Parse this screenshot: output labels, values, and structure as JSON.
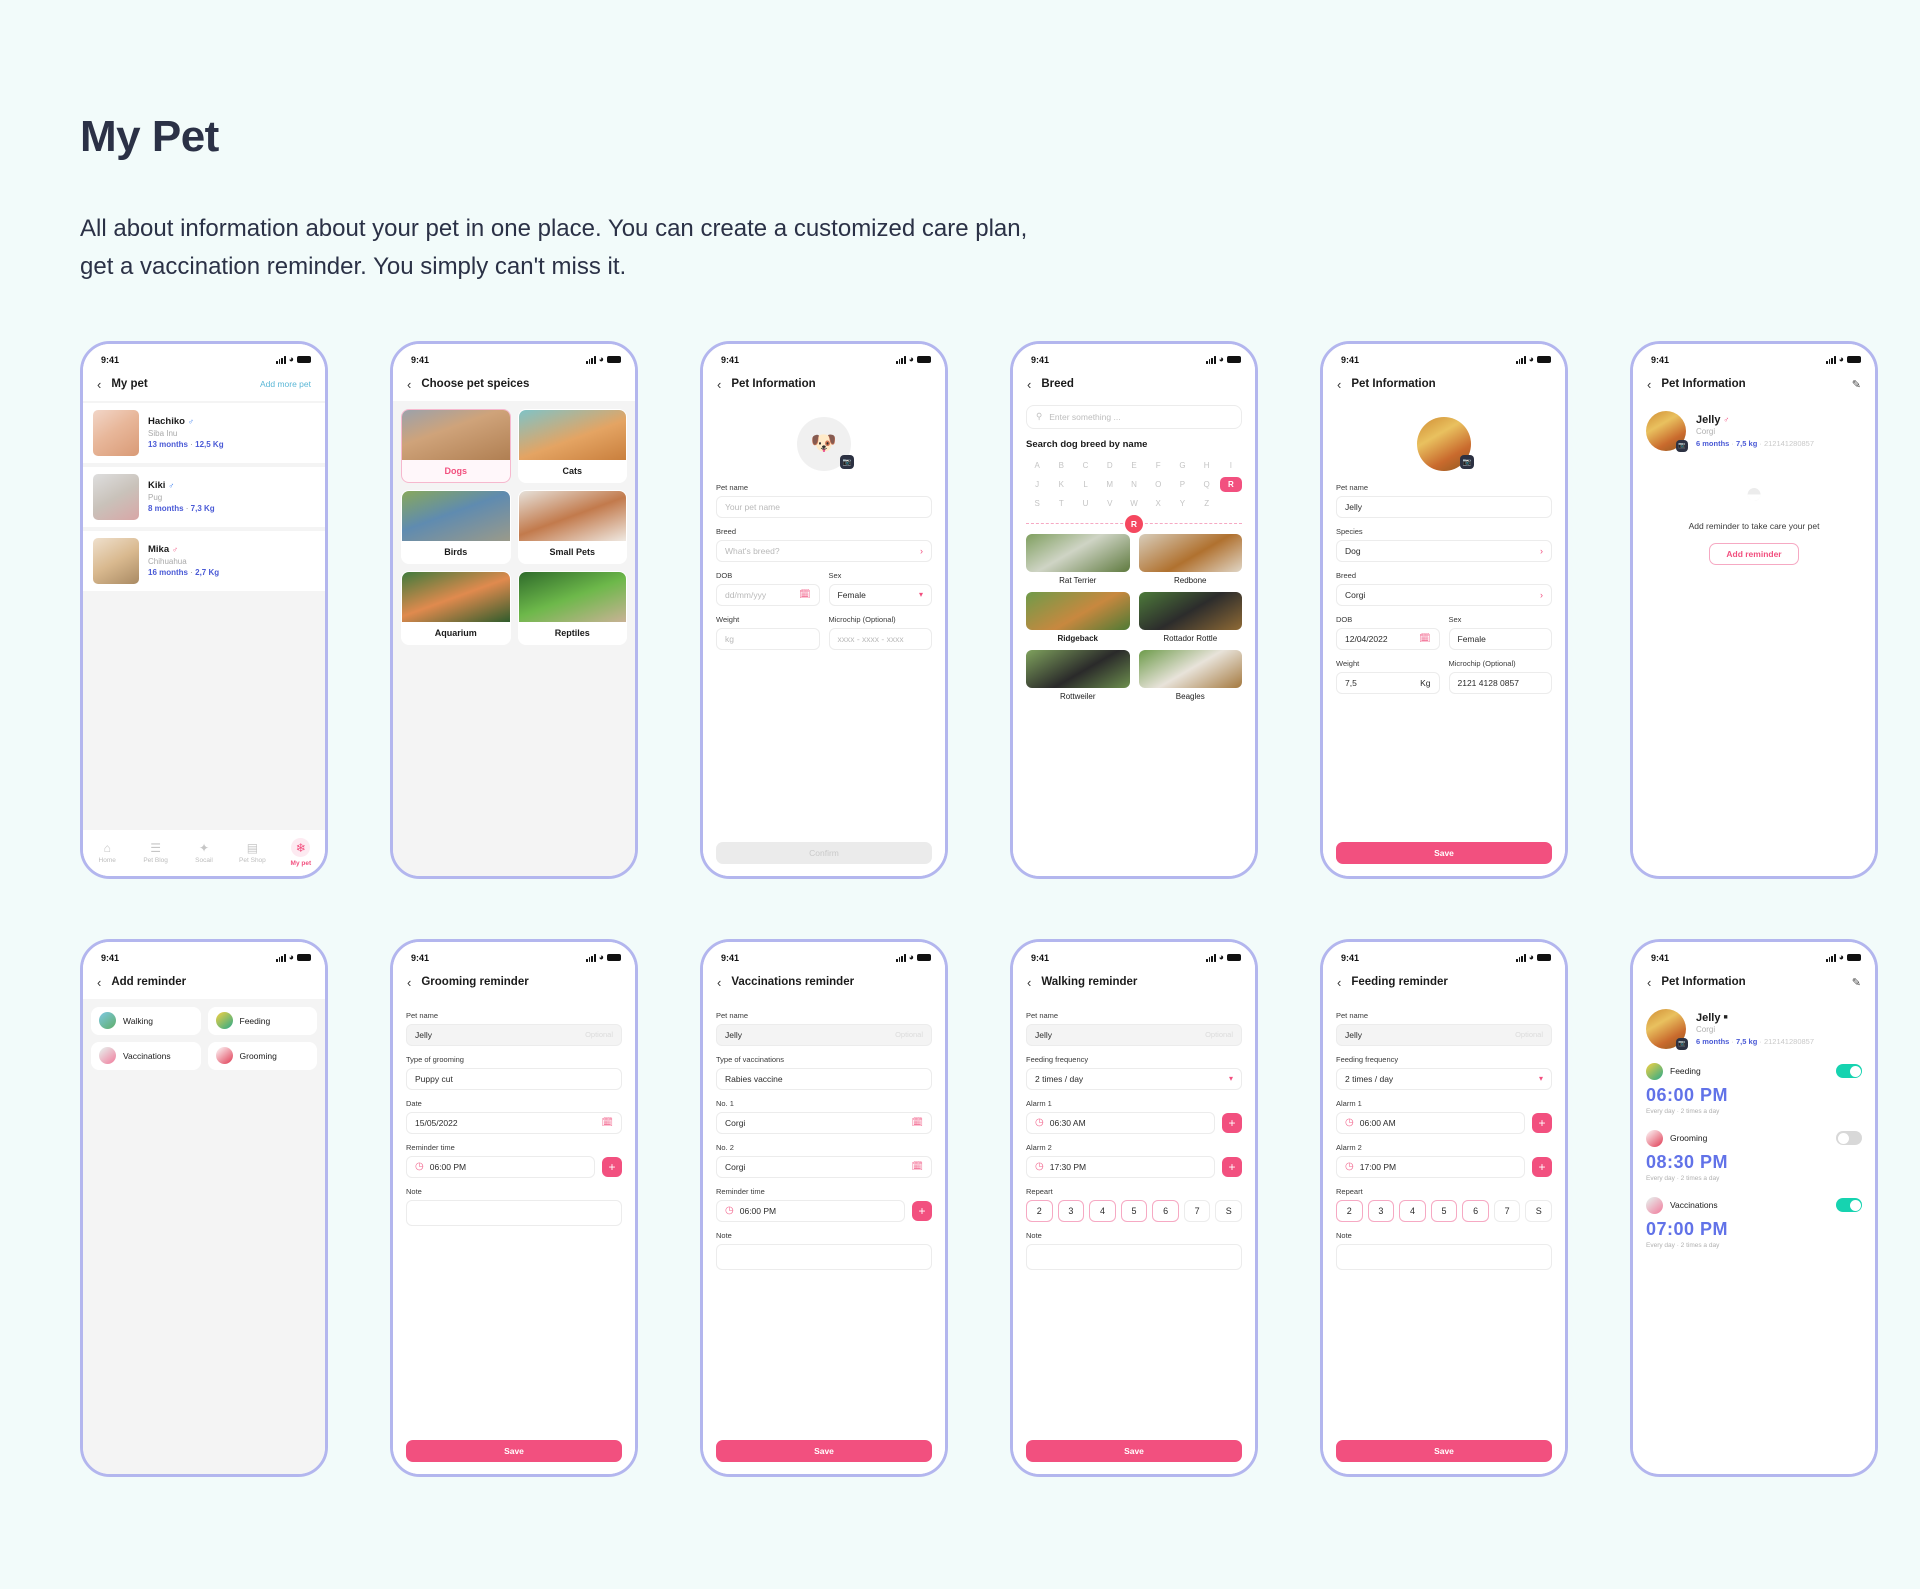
{
  "page": {
    "title": "My Pet",
    "subtitle": "All about information about your pet in one place. You can create a customized care plan, get a vaccination reminder. You simply can't miss it."
  },
  "status_bar": {
    "time": "9:41"
  },
  "colors": {
    "accent_pink": "#f2507f",
    "link_blue": "#4a5ad6",
    "toggle_green": "#16d3b0",
    "frame_purple": "#b3b6ee",
    "page_bg": "#f2fbfa"
  },
  "screens": {
    "my_pet": {
      "title": "My pet",
      "action": "Add more pet",
      "pets": [
        {
          "name": "Hachiko",
          "sex": "male",
          "breed": "Siba Inu",
          "age": "13 months",
          "weight": "12,5 Kg"
        },
        {
          "name": "Kiki",
          "sex": "male",
          "breed": "Pug",
          "age": "8 months",
          "weight": "7,3 Kg"
        },
        {
          "name": "Mika",
          "sex": "male",
          "breed": "Chihuahua",
          "age": "16 months",
          "weight": "2,7 Kg"
        }
      ],
      "tabs": [
        {
          "label": "Home",
          "icon": "home-icon",
          "active": false
        },
        {
          "label": "Pet Blog",
          "icon": "blog-icon",
          "active": false
        },
        {
          "label": "Socail",
          "icon": "social-icon",
          "active": false
        },
        {
          "label": "Pet Shop",
          "icon": "shop-icon",
          "active": false
        },
        {
          "label": "My pet",
          "icon": "paw-icon",
          "active": true
        }
      ]
    },
    "choose_species": {
      "title": "Choose pet speices",
      "items": [
        {
          "label": "Dogs",
          "selected": true
        },
        {
          "label": "Cats",
          "selected": false
        },
        {
          "label": "Birds",
          "selected": false
        },
        {
          "label": "Small Pets",
          "selected": false
        },
        {
          "label": "Aquarium",
          "selected": false
        },
        {
          "label": "Reptiles",
          "selected": false
        }
      ]
    },
    "pet_info_empty": {
      "title": "Pet Information",
      "fields": {
        "pet_name_label": "Pet name",
        "pet_name_placeholder": "Your pet name",
        "breed_label": "Breed",
        "breed_placeholder": "What's breed?",
        "dob_label": "DOB",
        "dob_placeholder": "dd/mm/yyy",
        "sex_label": "Sex",
        "sex_value": "Female",
        "weight_label": "Weight",
        "weight_placeholder": "kg",
        "microchip_label": "Microchip (Optional)",
        "microchip_placeholder": "xxxx - xxxx - xxxx"
      },
      "confirm_label": "Confirm"
    },
    "breed": {
      "title": "Breed",
      "search_placeholder": "Enter something ...",
      "section_title": "Search dog breed by name",
      "letters": [
        "A",
        "B",
        "C",
        "D",
        "E",
        "F",
        "G",
        "H",
        "I",
        "J",
        "K",
        "L",
        "M",
        "N",
        "O",
        "P",
        "Q",
        "R",
        "S",
        "T",
        "U",
        "V",
        "W",
        "X",
        "Y",
        "Z"
      ],
      "active_letter": "R",
      "results": [
        {
          "name": "Rat Terrier",
          "bold": false
        },
        {
          "name": "Redbone",
          "bold": false
        },
        {
          "name": "Ridgeback",
          "bold": true
        },
        {
          "name": "Rottador Rottle",
          "bold": false
        },
        {
          "name": "Rottweiler",
          "bold": false
        },
        {
          "name": "Beagles",
          "bold": false
        }
      ]
    },
    "pet_info_filled": {
      "title": "Pet Information",
      "fields": {
        "pet_name_label": "Pet name",
        "pet_name_value": "Jelly",
        "species_label": "Species",
        "species_value": "Dog",
        "breed_label": "Breed",
        "breed_value": "Corgi",
        "dob_label": "DOB",
        "dob_value": "12/04/2022",
        "sex_label": "Sex",
        "sex_value": "Female",
        "weight_label": "Weight",
        "weight_value": "7,5",
        "weight_unit": "Kg",
        "microchip_label": "Microchip (Optional)",
        "microchip_value": "2121 4128 0857"
      },
      "save_label": "Save"
    },
    "pet_info_no_reminder": {
      "title": "Pet Information",
      "pet": {
        "name": "Jelly",
        "sex": "male",
        "breed": "Corgi",
        "age": "6 months",
        "weight": "7,5 kg",
        "microchip": "212141280857"
      },
      "empty_text": "Add reminder to take care your pet",
      "add_button": "Add reminder"
    },
    "add_reminder": {
      "title": "Add reminder",
      "types": [
        {
          "label": "Walking",
          "icon": "walking-icon"
        },
        {
          "label": "Feeding",
          "icon": "feeding-icon"
        },
        {
          "label": "Vaccinations",
          "icon": "vaccinations-icon"
        },
        {
          "label": "Grooming",
          "icon": "grooming-icon"
        }
      ]
    },
    "grooming_reminder": {
      "title": "Grooming reminder",
      "pet_name_label": "Pet name",
      "pet_name_value": "Jelly",
      "pet_name_optional": "Optional",
      "type_label": "Type of grooming",
      "type_value": "Puppy cut",
      "date_label": "Date",
      "date_value": "15/05/2022",
      "reminder_time_label": "Reminder  time",
      "reminder_time_value": "06:00 PM",
      "note_label": "Note",
      "save_label": "Save"
    },
    "vaccinations_reminder": {
      "title": "Vaccinations reminder",
      "pet_name_label": "Pet name",
      "pet_name_value": "Jelly",
      "pet_name_optional": "Optional",
      "type_label": "Type of vaccinations",
      "type_value": "Rabies vaccine",
      "no1_label": "No. 1",
      "no1_value": "Corgi",
      "no2_label": "No. 2",
      "no2_value": "Corgi",
      "reminder_time_label": "Reminder  time",
      "reminder_time_value": "06:00 PM",
      "note_label": "Note",
      "save_label": "Save"
    },
    "walking_reminder": {
      "title": "Walking reminder",
      "pet_name_label": "Pet name",
      "pet_name_value": "Jelly",
      "pet_name_optional": "Optional",
      "frequency_label": "Feeding frequency",
      "frequency_value": "2 times / day",
      "alarm1_label": "Alarm 1",
      "alarm1_value": "06:30 AM",
      "alarm2_label": "Alarm 2",
      "alarm2_value": "17:30 PM",
      "repeat_label": "Repeart",
      "days": [
        {
          "label": "2",
          "on": true
        },
        {
          "label": "3",
          "on": true
        },
        {
          "label": "4",
          "on": true
        },
        {
          "label": "5",
          "on": true
        },
        {
          "label": "6",
          "on": true
        },
        {
          "label": "7",
          "on": false
        },
        {
          "label": "S",
          "on": false
        }
      ],
      "note_label": "Note",
      "save_label": "Save"
    },
    "feeding_reminder": {
      "title": "Feeding reminder",
      "pet_name_label": "Pet name",
      "pet_name_value": "Jelly",
      "pet_name_optional": "Optional",
      "frequency_label": "Feeding frequency",
      "frequency_value": "2 times / day",
      "alarm1_label": "Alarm 1",
      "alarm1_value": "06:00 AM",
      "alarm2_label": "Alarm 2",
      "alarm2_value": "17:00 PM",
      "repeat_label": "Repeart",
      "days": [
        {
          "label": "2",
          "on": true
        },
        {
          "label": "3",
          "on": true
        },
        {
          "label": "4",
          "on": true
        },
        {
          "label": "5",
          "on": true
        },
        {
          "label": "6",
          "on": true
        },
        {
          "label": "7",
          "on": false
        },
        {
          "label": "S",
          "on": false
        }
      ],
      "note_label": "Note",
      "save_label": "Save"
    },
    "pet_info_reminders": {
      "title": "Pet Information",
      "pet": {
        "name": "Jelly",
        "sex": "male",
        "breed": "Corgi",
        "age": "6 months",
        "weight": "7,5 kg",
        "microchip": "212141280857"
      },
      "reminders": [
        {
          "label": "Feeding",
          "time": "06:00 PM",
          "sub": "Every day  ·  2 times a day",
          "on": true,
          "icon": "feeding-icon"
        },
        {
          "label": "Grooming",
          "time": "08:30 PM",
          "sub": "Every day  ·  2 times a day",
          "on": false,
          "icon": "grooming-icon"
        },
        {
          "label": "Vaccinations",
          "time": "07:00 PM",
          "sub": "Every day  ·  2 times a day",
          "on": true,
          "icon": "vaccinations-icon"
        }
      ]
    }
  }
}
